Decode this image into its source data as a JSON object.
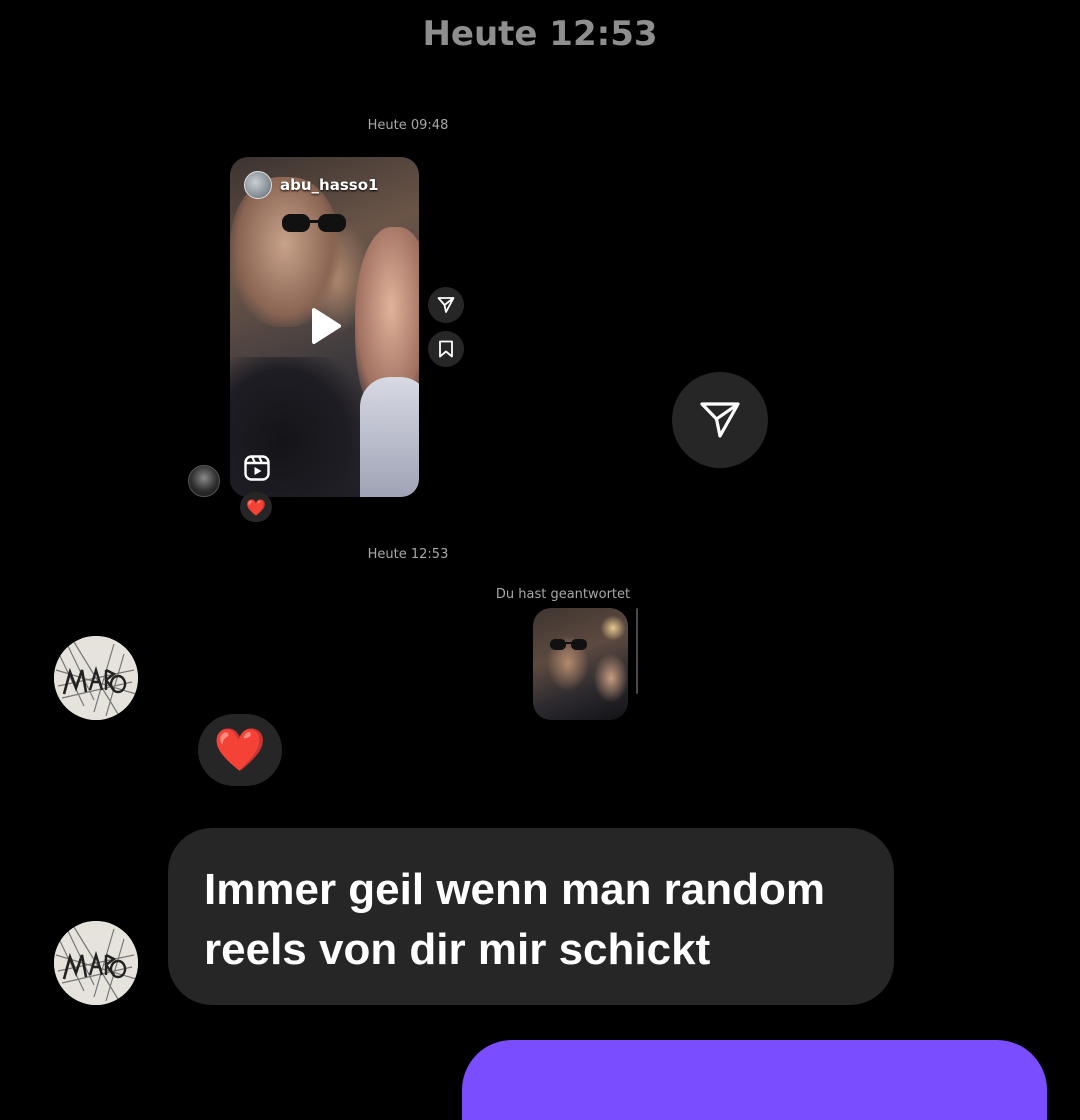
{
  "conversation": {
    "top_timestamp": "Heute 12:53",
    "shared_reel": {
      "timestamp": "Heute 09:48",
      "username": "abu_hasso1",
      "reaction": "❤️",
      "icons": [
        "play-icon",
        "reels-icon",
        "send-icon",
        "bookmark-icon"
      ]
    },
    "reply": {
      "timestamp": "Heute 12:53",
      "label": "Du hast geantwortet"
    },
    "heart_reaction": "❤️",
    "message": {
      "text": "Immer geil wenn man random reels von dir mir schickt"
    }
  },
  "colors": {
    "background": "#000000",
    "bubble": "#262626",
    "timestamp": "#8e8e8e",
    "own_message": "#7a4dff"
  }
}
